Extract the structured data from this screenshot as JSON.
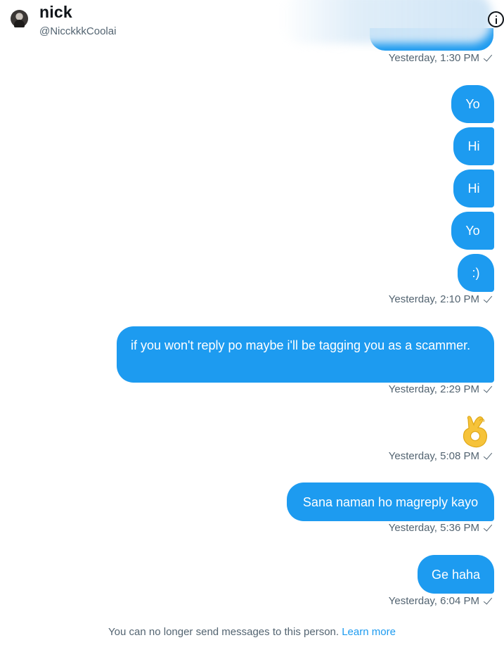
{
  "header": {
    "display_name": "nick",
    "handle": "@NicckkkCoolai",
    "avatar_icon": "avatar-photo",
    "info_icon": "info-icon"
  },
  "messages": [
    {
      "text": "Yo"
    },
    {
      "text": "Hi"
    },
    {
      "text": "Hi"
    },
    {
      "text": "Yo"
    },
    {
      "text": ":)"
    },
    {
      "text": "if you won't reply po maybe i'll be tagging you as a scammer."
    },
    {
      "text": "👌"
    },
    {
      "text": "Sana naman ho magreply kayo"
    },
    {
      "text": "Ge haha"
    }
  ],
  "timestamps": [
    "Yesterday, 1:30 PM",
    "Yesterday, 2:10 PM",
    "Yesterday, 2:29 PM",
    "Yesterday, 5:08 PM",
    "Yesterday, 5:36 PM",
    "Yesterday, 6:04 PM"
  ],
  "footer": {
    "notice": "You can no longer send messages to this person.",
    "learn_more": "Learn more"
  },
  "colors": {
    "bubble": "#1d9bf0",
    "secondary_text": "#536471",
    "link": "#1d9bf0"
  }
}
